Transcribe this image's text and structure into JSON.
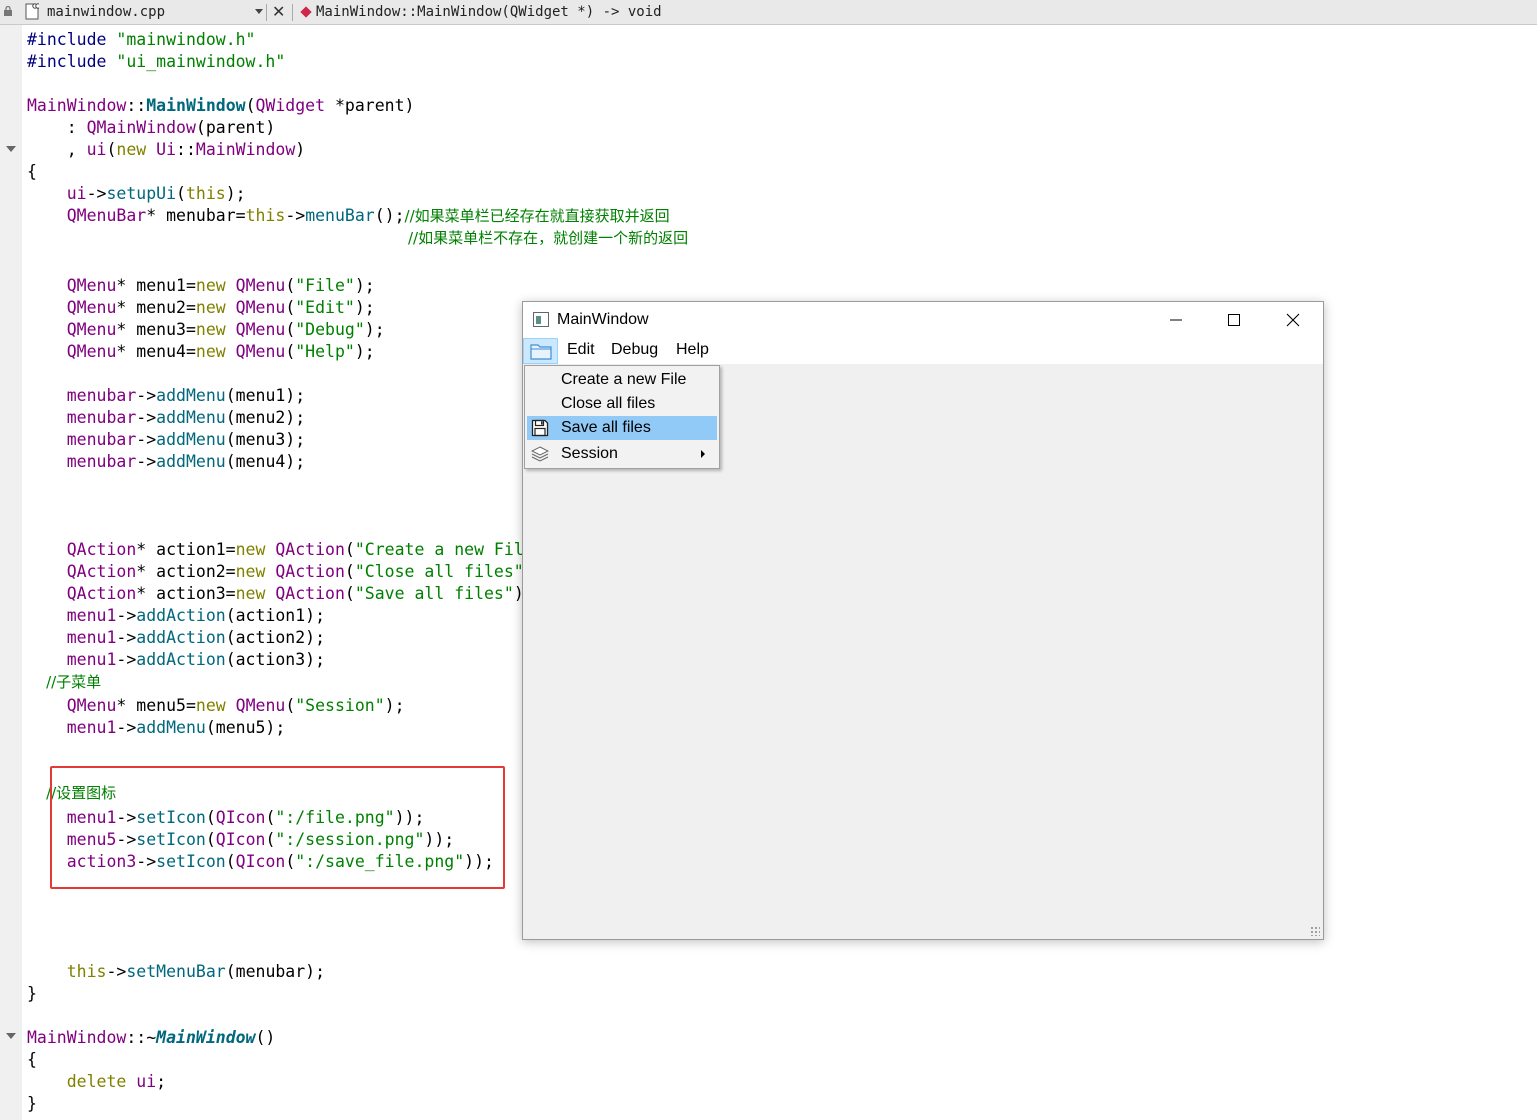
{
  "editor": {
    "file_name": "mainwindow.cpp",
    "symbol": "MainWindow::MainWindow(QWidget *) -> void"
  },
  "code": {
    "l1_dir": "#include",
    "l1_str": " \"mainwindow.h\"",
    "l2_dir": "#include",
    "l2_str": " \"ui_mainwindow.h\"",
    "l4_a": "MainWindow",
    "l4_b": "::",
    "l4_c": "MainWindow",
    "l4_d": "(",
    "l4_e": "QWidget",
    "l4_f": " *parent)",
    "l5_a": "    : ",
    "l5_b": "QMainWindow",
    "l5_c": "(parent)",
    "l6_a": "    , ",
    "l6_b": "ui",
    "l6_c": "(",
    "l6_d": "new",
    "l6_e": " Ui",
    "l6_f": "::",
    "l6_g": "MainWindow",
    "l6_h": ")",
    "l7": "{",
    "l8_a": "    ui",
    "l8_b": "->",
    "l8_c": "setupUi",
    "l8_d": "(",
    "l8_e": "this",
    "l8_f": ");",
    "l9_a": "    QMenuBar",
    "l9_b": "* menubar=",
    "l9_c": "this",
    "l9_d": "->",
    "l9_e": "menuBar",
    "l9_f": "();",
    "l9_g": "//如果菜单栏已经存在就直接获取并返回",
    "l10": "//如果菜单栏不存在，就创建一个新的返回",
    "m1_a": "    QMenu",
    "m1_b": "* menu1=",
    "m1_c": "new",
    "m1_d": " QMenu",
    "m1_e": "(",
    "m1_f": "\"File\"",
    "m1_g": ");",
    "m2_a": "    QMenu",
    "m2_b": "* menu2=",
    "m2_c": "new",
    "m2_d": " QMenu",
    "m2_e": "(",
    "m2_f": "\"Edit\"",
    "m2_g": ");",
    "m3_a": "    QMenu",
    "m3_b": "* menu3=",
    "m3_c": "new",
    "m3_d": " QMenu",
    "m3_e": "(",
    "m3_f": "\"Debug\"",
    "m3_g": ");",
    "m4_a": "    QMenu",
    "m4_b": "* menu4=",
    "m4_c": "new",
    "m4_d": " QMenu",
    "m4_e": "(",
    "m4_f": "\"Help\"",
    "m4_g": ");",
    "a1_a": "    menubar",
    "a1_b": "->",
    "a1_c": "addMenu",
    "a1_d": "(menu1);",
    "a2_a": "    menubar",
    "a2_b": "->",
    "a2_c": "addMenu",
    "a2_d": "(menu2);",
    "a3_a": "    menubar",
    "a3_b": "->",
    "a3_c": "addMenu",
    "a3_d": "(menu3);",
    "a4_a": "    menubar",
    "a4_b": "->",
    "a4_c": "addMenu",
    "a4_d": "(menu4);",
    "q1_a": "    QAction",
    "q1_b": "* action1=",
    "q1_c": "new",
    "q1_d": " QAction",
    "q1_e": "(",
    "q1_f": "\"Create a new Fil",
    "q2_a": "    QAction",
    "q2_b": "* action2=",
    "q2_c": "new",
    "q2_d": " QAction",
    "q2_e": "(",
    "q2_f": "\"Close all files\"",
    "q3_a": "    QAction",
    "q3_b": "* action3=",
    "q3_c": "new",
    "q3_d": " QAction",
    "q3_e": "(",
    "q3_f": "\"Save all files\"",
    "q3_g": ")",
    "aa1_a": "    menu1",
    "aa1_b": "->",
    "aa1_c": "addAction",
    "aa1_d": "(action1);",
    "aa2_a": "    menu1",
    "aa2_b": "->",
    "aa2_c": "addAction",
    "aa2_d": "(action2);",
    "aa3_a": "    menu1",
    "aa3_b": "->",
    "aa3_c": "addAction",
    "aa3_d": "(action3);",
    "cm_sub": "    //子菜单",
    "m5_a": "    QMenu",
    "m5_b": "* menu5=",
    "m5_c": "new",
    "m5_d": " QMenu",
    "m5_e": "(",
    "m5_f": "\"Session\"",
    "m5_g": ");",
    "am5_a": "    menu1",
    "am5_b": "->",
    "am5_c": "addMenu",
    "am5_d": "(menu5);",
    "cm_icon": "    //设置图标",
    "si1_a": "    menu1",
    "si1_b": "->",
    "si1_c": "setIcon",
    "si1_d": "(",
    "si1_e": "QIcon",
    "si1_f": "(",
    "si1_g": "\":/file.png\"",
    "si1_h": "));",
    "si2_a": "    menu5",
    "si2_b": "->",
    "si2_c": "setIcon",
    "si2_d": "(",
    "si2_e": "QIcon",
    "si2_f": "(",
    "si2_g": "\":/session.png\"",
    "si2_h": "));",
    "si3_a": "    action3",
    "si3_b": "->",
    "si3_c": "setIcon",
    "si3_d": "(",
    "si3_e": "QIcon",
    "si3_f": "(",
    "si3_g": "\":/save_file.png\"",
    "si3_h": "));",
    "smb_a": "    this",
    "smb_b": "->",
    "smb_c": "setMenuBar",
    "smb_d": "(menubar);",
    "close1": "}",
    "d_a": "MainWindow",
    "d_b": "::~",
    "d_c": "MainWindow",
    "d_d": "()",
    "d_open": "{",
    "d_del_a": "    delete",
    "d_del_b": " ui",
    "d_del_c": ";",
    "d_close": "}"
  },
  "window": {
    "title": "MainWindow",
    "minimize": "—",
    "maximize": "☐",
    "close": "✕",
    "menubar": [
      "Edit",
      "Debug",
      "Help"
    ],
    "menu_items": [
      {
        "label": "Create a new File",
        "icon": "none"
      },
      {
        "label": "Close all files",
        "icon": "none"
      },
      {
        "label": "Save all files",
        "icon": "save-icon",
        "highlighted": true
      },
      {
        "label": "Session",
        "icon": "session-icon",
        "submenu": true
      }
    ]
  },
  "colors": {
    "keyword": "#808000",
    "type": "#800080",
    "function": "#00677c",
    "string": "#008000",
    "highlight_box": "#e53935",
    "menu_highlight": "#91c9f7"
  }
}
